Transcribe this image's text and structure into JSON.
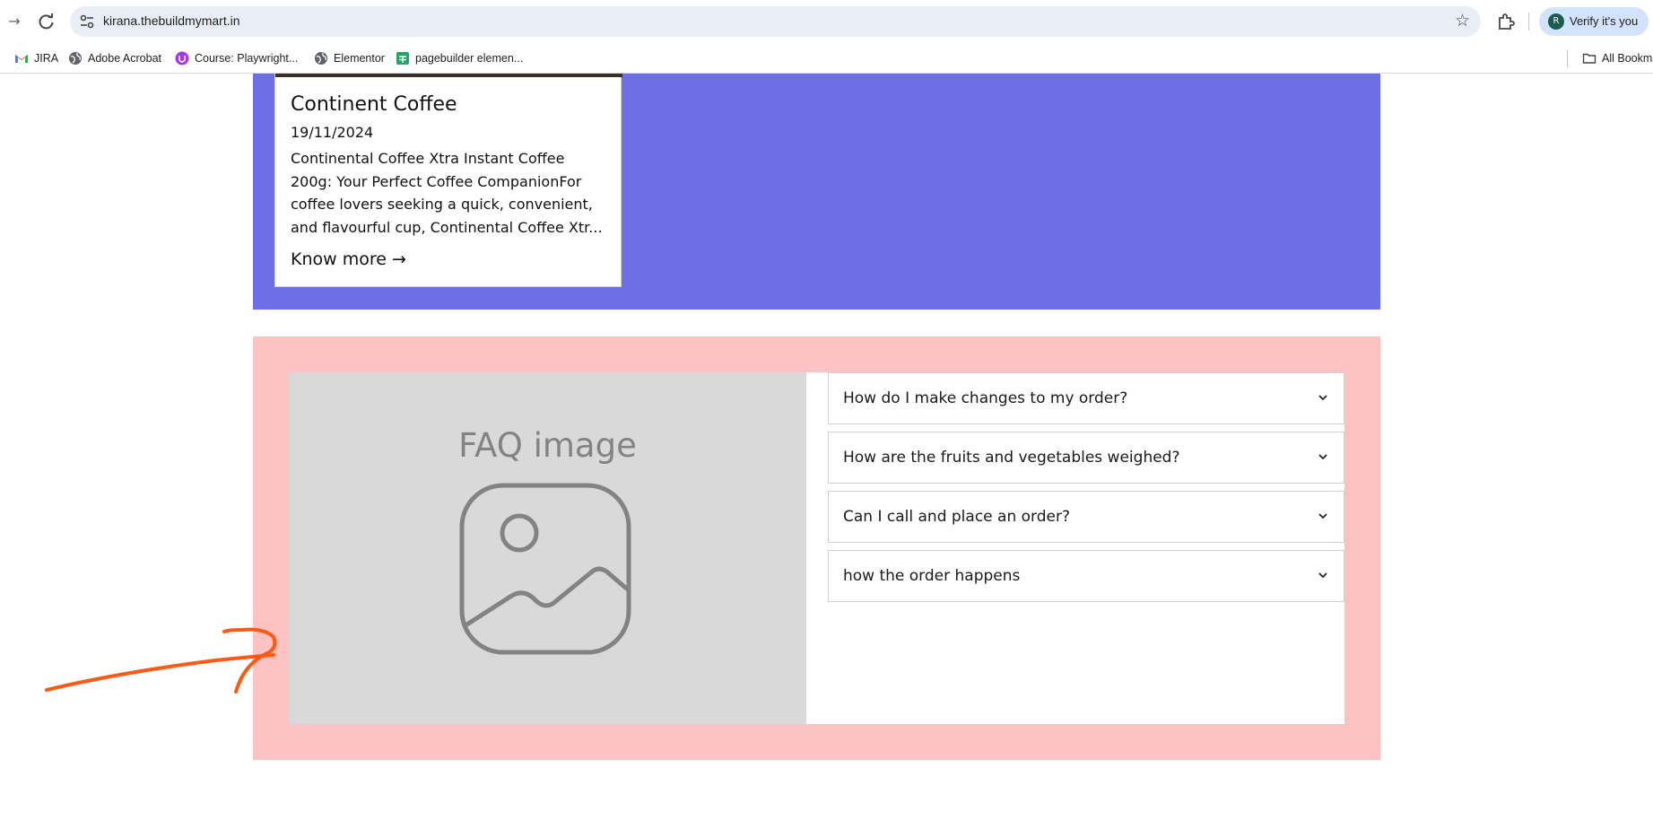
{
  "browser": {
    "url": "kirana.thebuildmymart.in",
    "verify_label": "Verify it's you",
    "avatar_letter": "R",
    "bookmarks": [
      {
        "label": "JIRA",
        "icon": "gmail-icon"
      },
      {
        "label": "Adobe Acrobat",
        "icon": "globe-icon"
      },
      {
        "label": "Course: Playwright...",
        "icon": "udemy-icon"
      },
      {
        "label": "Elementor",
        "icon": "globe-icon"
      },
      {
        "label": "pagebuilder elemen...",
        "icon": "sheets-icon"
      }
    ],
    "all_bookmarks": "All Bookmarks"
  },
  "post": {
    "title": "Continent Coffee",
    "date": "19/11/2024",
    "excerpt": "Continental Coffee Xtra Instant Coffee 200g: Your Perfect Coffee CompanionFor coffee lovers seeking a quick, convenient, and flavourful cup, Continental Coffee Xtr...",
    "more": "Know more →"
  },
  "faq": {
    "image_label": "FAQ image",
    "items": [
      {
        "question": "How do I make changes to my order?"
      },
      {
        "question": "How are the fruits and vegetables weighed?"
      },
      {
        "question": "Can I call and place an order?"
      },
      {
        "question": "how the order happens"
      }
    ]
  },
  "colors": {
    "blue_section": "#6e6ee6",
    "pink_section": "#ffc2c2",
    "annotation_arrow": "#ff5a14"
  }
}
